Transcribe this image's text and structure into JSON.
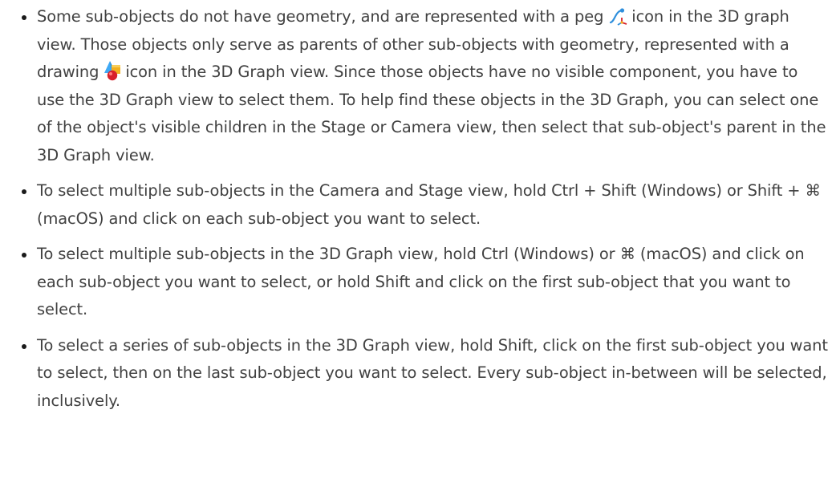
{
  "bullets": [
    {
      "parts": [
        "Some sub-objects do not have geometry, and are represented with a peg",
        "icon in the 3D graph view. Those objects only serve as parents of other sub-objects with geometry, represented with a drawing",
        "icon in the 3D Graph view. Since those objects have no visible component, you have to use the 3D Graph view to select them. To help find these objects in the 3D Graph, you can select one of the object's visible children in the Stage or Camera view, then select that sub-object's parent in the 3D Graph view."
      ],
      "icons": [
        "peg-icon",
        "drawing-icon"
      ]
    },
    {
      "text": "To select multiple sub-objects in the Camera and Stage view, hold Ctrl + Shift (Windows) or Shift + ⌘ (macOS) and click on each sub-object you want to select."
    },
    {
      "text": "To select multiple sub-objects in the 3D Graph view, hold Ctrl (Windows) or ⌘ (macOS) and click on each sub-object you want to select, or hold Shift and click on the first sub-object that you want to select."
    },
    {
      "text": "To select a series of sub-objects in the 3D Graph view, hold Shift, click on the first sub-object you want to select, then on the last sub-object you want to select. Every sub-object in-between will be selected, inclusively."
    }
  ],
  "colors": {
    "text": "#414141",
    "bullet": "#1a1a1a",
    "peg_icon_blue": "#2f8fdc",
    "drawing_icon_red": "#d8202a",
    "drawing_icon_yellow": "#f2b01e",
    "drawing_icon_blue": "#3fa9f5"
  }
}
